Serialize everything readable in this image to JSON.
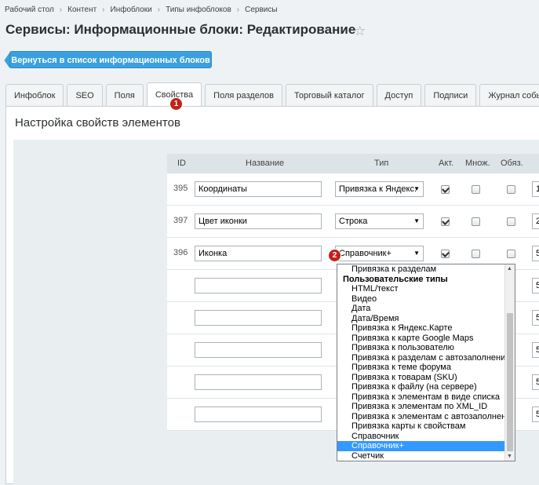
{
  "breadcrumb": [
    "Рабочий стол",
    "Контент",
    "Инфоблоки",
    "Типы инфоблоков",
    "Сервисы"
  ],
  "page_title": "Сервисы: Информационные блоки: Редактирование",
  "back_button": "Вернуться в список информационных блоков",
  "tabs": [
    "Инфоблок",
    "SEO",
    "Поля",
    "Свойства",
    "Поля разделов",
    "Торговый каталог",
    "Доступ",
    "Подписи",
    "Журнал событ"
  ],
  "active_tab": "Свойства",
  "badges": [
    "1",
    "2"
  ],
  "section_title": "Настройка свойств элементов",
  "table": {
    "headers": {
      "id": "ID",
      "name": "Название",
      "type": "Тип",
      "active": "Акт.",
      "multiple": "Множ.",
      "required": "Обяз."
    },
    "rows": [
      {
        "id": "395",
        "name": "Координаты",
        "type": "Привязка к Яндекс.",
        "active": true,
        "multiple": false,
        "required": false,
        "sort": "1"
      },
      {
        "id": "397",
        "name": "Цвет иконки",
        "type": "Строка",
        "active": true,
        "multiple": false,
        "required": false,
        "sort": "2"
      },
      {
        "id": "396",
        "name": "Иконка",
        "type": "Справочник+",
        "active": true,
        "multiple": false,
        "required": false,
        "sort": "5"
      },
      {
        "id": "",
        "name": "",
        "type": "",
        "active": false,
        "multiple": false,
        "required": false,
        "sort": "5"
      },
      {
        "id": "",
        "name": "",
        "type": "",
        "active": false,
        "multiple": false,
        "required": false,
        "sort": "5"
      },
      {
        "id": "",
        "name": "",
        "type": "",
        "active": false,
        "multiple": false,
        "required": false,
        "sort": "5"
      },
      {
        "id": "",
        "name": "",
        "type": "",
        "active": false,
        "multiple": false,
        "required": false,
        "sort": "5"
      },
      {
        "id": "",
        "name": "",
        "type": "",
        "active": false,
        "multiple": false,
        "required": false,
        "sort": "5"
      }
    ]
  },
  "dropdown": {
    "items": [
      {
        "label": "Привязка к разделам",
        "group": false
      },
      {
        "label": "Пользовательские типы",
        "group": true
      },
      {
        "label": "HTML/текст",
        "group": false
      },
      {
        "label": "Видео",
        "group": false
      },
      {
        "label": "Дата",
        "group": false
      },
      {
        "label": "Дата/Время",
        "group": false
      },
      {
        "label": "Привязка к Яндекс.Карте",
        "group": false
      },
      {
        "label": "Привязка к карте Google Maps",
        "group": false
      },
      {
        "label": "Привязка к пользователю",
        "group": false
      },
      {
        "label": "Привязка к разделам с автозаполнением",
        "group": false
      },
      {
        "label": "Привязка к теме форума",
        "group": false
      },
      {
        "label": "Привязка к товарам (SKU)",
        "group": false
      },
      {
        "label": "Привязка к файлу (на сервере)",
        "group": false
      },
      {
        "label": "Привязка к элементам в виде списка",
        "group": false
      },
      {
        "label": "Привязка к элементам по XML_ID",
        "group": false
      },
      {
        "label": "Привязка к элементам с автозаполнением",
        "group": false
      },
      {
        "label": "Привязка карты к свойствам",
        "group": false
      },
      {
        "label": "Справочник",
        "group": false
      },
      {
        "label": "Справочник+",
        "group": false,
        "selected": true
      },
      {
        "label": "Счетчик",
        "group": false
      }
    ]
  },
  "colors": {
    "accent": "#3aa0df",
    "badge": "#c0221b",
    "selection": "#3399ff"
  }
}
